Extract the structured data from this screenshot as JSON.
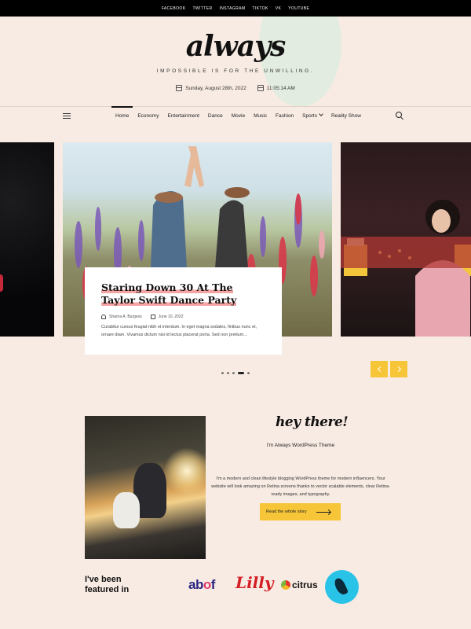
{
  "topbar": {
    "social_links": [
      "FACEBOOK",
      "TWITTER",
      "INSTAGRAM",
      "TIKTOK",
      "VK",
      "YOUTUBE"
    ]
  },
  "header": {
    "logo": "always",
    "tagline": "IMPOSSIBLE IS FOR THE UNWILLING.",
    "date": "Sunday, August 28th, 2022",
    "time": "11:05:14 AM"
  },
  "nav": {
    "items": [
      "Home",
      "Economy",
      "Entertainment",
      "Dance",
      "Movie",
      "Music",
      "Fashion",
      "Sports",
      "Reality Show"
    ],
    "active": "Home"
  },
  "slider": {
    "featured": {
      "title": "Staring Down 30 At The Taylor Swift Dance Party",
      "author": "Sharna A. Burgess",
      "date": "June 10, 2022",
      "excerpt": "Curabitur cursus feugiat nibh et interdum. In eget magna sodales, finibus nunc et, ornare diam. Vivamus dictum nisi id lectus placerat porta. Sed non pretium..."
    },
    "slide_count": 5,
    "active_slide": 4
  },
  "about": {
    "script_title": "hey there!",
    "subtitle": "I'm Always WordPress Theme",
    "text": "I'm a modern and clean lifestyle blogging WordPress theme for modern influencers. Your website will look amazing on Retina screens thanks to vector scalable elements, clear Retina-ready images, and typography.",
    "button": "Read the whole story"
  },
  "featured_in": {
    "label": "I've been featured in",
    "logos": [
      "abof",
      "Lilly",
      "citrus",
      "bird-logo"
    ],
    "abof_a": "ab",
    "abof_o": "o",
    "abof_f": "f",
    "lilly": "Lilly",
    "citrus": "citrus"
  }
}
